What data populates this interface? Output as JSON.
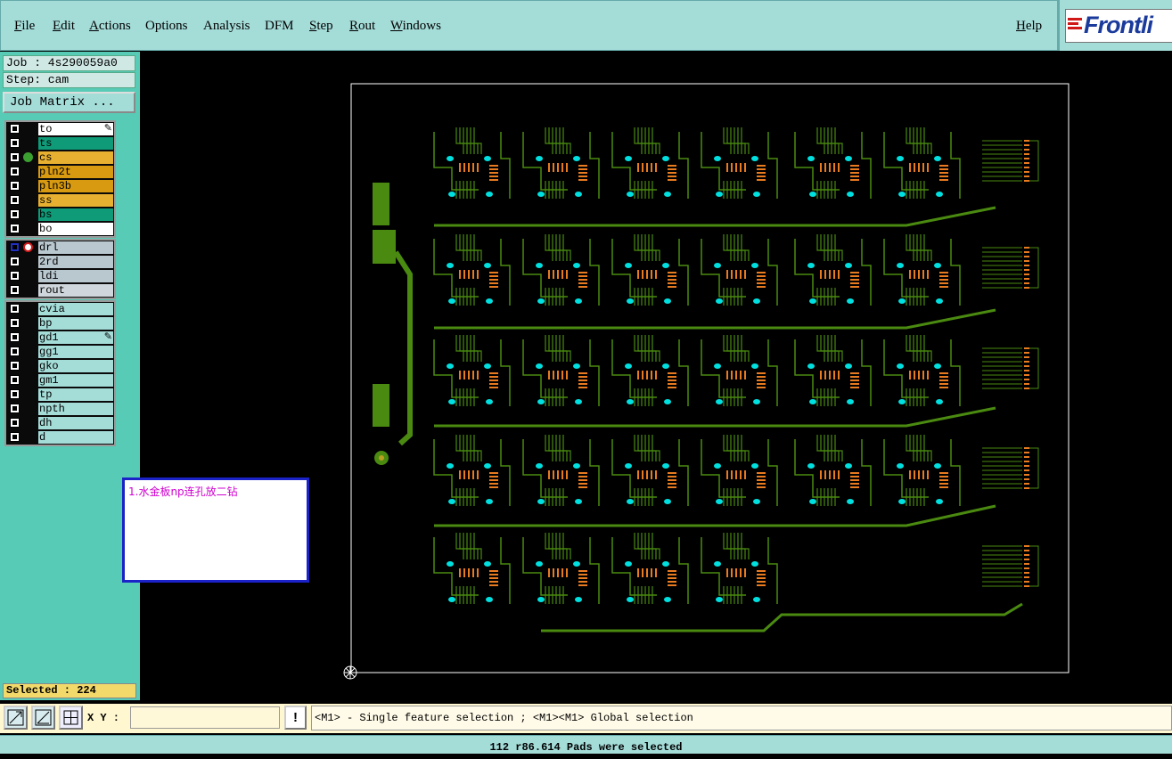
{
  "menu": {
    "file": "File",
    "edit": "Edit",
    "actions": "Actions",
    "options": "Options",
    "analysis": "Analysis",
    "dfm": "DFM",
    "step": "Step",
    "rout": "Rout",
    "windows": "Windows",
    "help": "Help"
  },
  "logo": {
    "text": "Frontli"
  },
  "job": {
    "label": "Job : 4s290059a0",
    "step": "Step: cam",
    "matrix_button": "Job Matrix ..."
  },
  "layers": {
    "group1": [
      {
        "name": "to",
        "color": "#ffffff",
        "marker": "pencil"
      },
      {
        "name": "ts",
        "color": "#0f9a78"
      },
      {
        "name": "cs",
        "color": "#e8b030",
        "marker": "dot"
      },
      {
        "name": "pln2t",
        "color": "#d89a10"
      },
      {
        "name": "pln3b",
        "color": "#d89a10"
      },
      {
        "name": "ss",
        "color": "#e8b030"
      },
      {
        "name": "bs",
        "color": "#0f9a78"
      },
      {
        "name": "bo",
        "color": "#ffffff"
      }
    ],
    "group2": [
      {
        "name": "drl",
        "color": "#b9c7cf",
        "marker": "nosign"
      },
      {
        "name": "2rd",
        "color": "#b9c7cf"
      },
      {
        "name": "ldi",
        "color": "#b9c7cf"
      },
      {
        "name": "rout",
        "color": "#cfd7dc"
      }
    ],
    "group3": [
      {
        "name": "cvia",
        "color": "#a4dcd8"
      },
      {
        "name": "bp",
        "color": "#a4dcd8"
      },
      {
        "name": "gd1",
        "color": "#a4dcd8",
        "marker": "pencil"
      },
      {
        "name": "gg1",
        "color": "#a4dcd8"
      },
      {
        "name": "gko",
        "color": "#a4dcd8"
      },
      {
        "name": "gm1",
        "color": "#a4dcd8"
      },
      {
        "name": "tp",
        "color": "#a4dcd8"
      },
      {
        "name": "npth",
        "color": "#a4dcd8"
      },
      {
        "name": "dh",
        "color": "#a4dcd8"
      },
      {
        "name": "d",
        "color": "#a4dcd8"
      }
    ]
  },
  "note": {
    "text": "1.水金板np连孔放二钻"
  },
  "selected": {
    "text": "Selected : 224"
  },
  "toolbar": {
    "xy_label": "X Y :",
    "xy_value": "",
    "bang": "!",
    "hint": "<M1> - Single feature selection ; <M1><M1> Global selection"
  },
  "status": {
    "text": "112 r86.614 Pads were selected"
  },
  "colors": {
    "trace": "#4a8a10",
    "pad_cyan": "#00e0e0",
    "orange": "#e87a20",
    "board_outline": "#ffffff",
    "panel": "#58cbb6",
    "menubar": "#a4dcd8"
  }
}
